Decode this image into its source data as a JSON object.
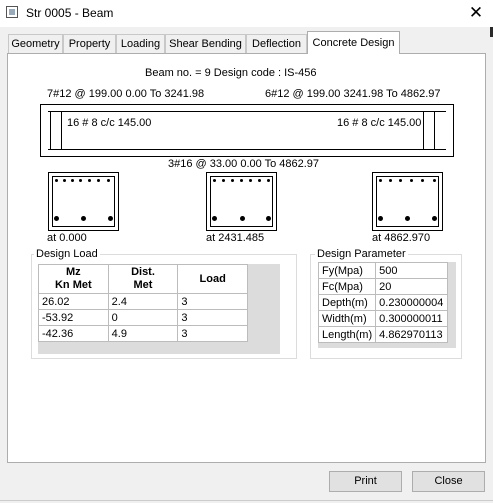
{
  "window": {
    "title": "Str  0005 - Beam",
    "close_glyph": "✕"
  },
  "tabs": [
    "Geometry",
    "Property",
    "Loading",
    "Shear Bending",
    "Deflection",
    "Concrete Design"
  ],
  "active_tab": "Concrete Design",
  "header": {
    "beam_info": "Beam no. = 9  Design code :  IS-456"
  },
  "beam": {
    "top_left_bars": "7#12 @ 199.00 0.00 To 3241.98",
    "top_right_bars": "6#12 @ 199.00 3241.98 To 4862.97",
    "stirrups_left": "16 # 8  c/c  145.00",
    "stirrups_right": "16 # 8  c/c  145.00",
    "bottom_bars": "3#16 @ 33.00 0.00 To 4862.97"
  },
  "sections": [
    {
      "label": "at 0.000"
    },
    {
      "label": "at 2431.485"
    },
    {
      "label": "at 4862.970"
    }
  ],
  "design_load": {
    "title": "Design Load",
    "headers": [
      [
        "Mz",
        "Kn Met"
      ],
      [
        "Dist.",
        "Met"
      ],
      [
        "Load"
      ]
    ],
    "rows": [
      [
        "26.02",
        "2.4",
        "3"
      ],
      [
        "-53.92",
        "0",
        "3"
      ],
      [
        "-42.36",
        "4.9",
        "3"
      ]
    ]
  },
  "design_parameter": {
    "title": "Design Parameter",
    "rows": [
      [
        "Fy(Mpa)",
        "500"
      ],
      [
        "Fc(Mpa)",
        "20"
      ],
      [
        "Depth(m)",
        "0.230000004"
      ],
      [
        "Width(m)",
        "0.300000011"
      ],
      [
        "Length(m)",
        "4.862970113"
      ]
    ]
  },
  "buttons": {
    "print": "Print",
    "close": "Close"
  }
}
